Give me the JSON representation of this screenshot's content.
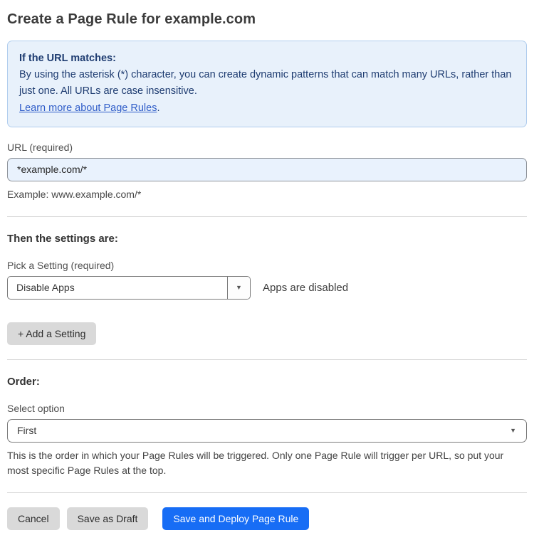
{
  "page": {
    "title": "Create a Page Rule for example.com"
  },
  "info_box": {
    "heading": "If the URL matches:",
    "body": "By using the asterisk (*) character, you can create dynamic patterns that can match many URLs, rather than just one. All URLs are case insensitive.",
    "link_text": "Learn more about Page Rules",
    "link_suffix": "."
  },
  "url_field": {
    "label": "URL (required)",
    "value": "*example.com/*",
    "helper": "Example: www.example.com/*"
  },
  "settings_section": {
    "heading": "Then the settings are:",
    "picker_label": "Pick a Setting (required)",
    "picker_value": "Disable Apps",
    "status_text": "Apps are disabled",
    "add_setting_label": "+ Add a Setting"
  },
  "order_section": {
    "heading": "Order:",
    "select_label": "Select option",
    "select_value": "First",
    "helper": "This is the order in which your Page Rules will be triggered. Only one Page Rule will trigger per URL, so put your most specific Page Rules at the top."
  },
  "footer": {
    "cancel_label": "Cancel",
    "save_draft_label": "Save as Draft",
    "save_deploy_label": "Save and Deploy Page Rule"
  },
  "icons": {
    "dropdown_arrow": "▼"
  },
  "colors": {
    "accent_blue": "#176df5",
    "info_bg": "#e8f1fb",
    "info_border": "#b0cdee",
    "info_text": "#1e3c71",
    "link_blue": "#2e5cc8",
    "input_bg": "#e9f2fd",
    "button_gray": "#d9d9d9"
  }
}
